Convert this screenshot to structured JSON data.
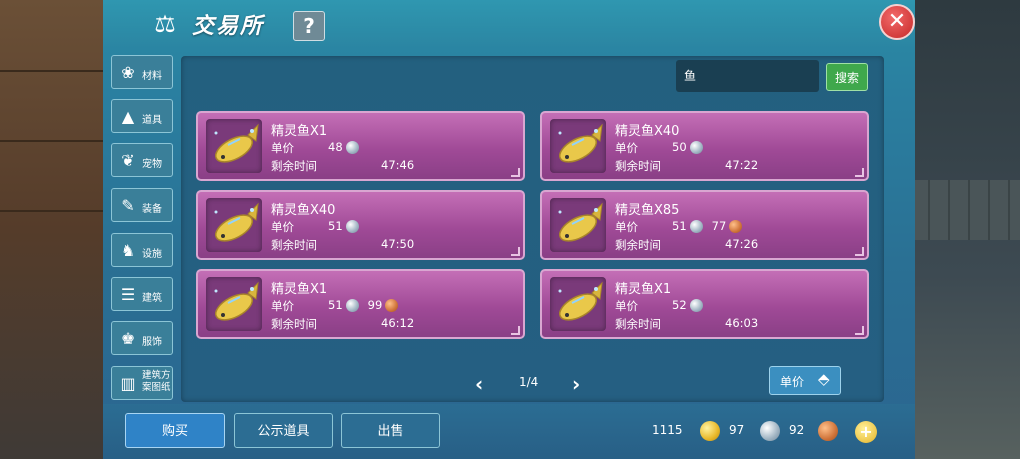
{
  "window": {
    "title": "交易所",
    "help_label": "?",
    "close_label": "✕"
  },
  "categories": [
    {
      "label": "材料",
      "icon": "material-icon",
      "glyph": "❀"
    },
    {
      "label": "道具",
      "icon": "tool-icon",
      "glyph": "▲"
    },
    {
      "label": "宠物",
      "icon": "pet-paw-icon",
      "glyph": "❦"
    },
    {
      "label": "装备",
      "icon": "equipment-icon",
      "glyph": "✎"
    },
    {
      "label": "设施",
      "icon": "facility-icon",
      "glyph": "♞"
    },
    {
      "label": "建筑",
      "icon": "building-icon",
      "glyph": "☰"
    },
    {
      "label": "服饰",
      "icon": "clothing-icon",
      "glyph": "♚"
    },
    {
      "label": "建筑方案图纸",
      "icon": "blueprint-icon",
      "glyph": "▥"
    }
  ],
  "search": {
    "value": "鱼",
    "button_label": "搜索"
  },
  "price_label": "单价",
  "time_label": "剩余时间",
  "items": [
    {
      "name": "精灵鱼X1",
      "silver": "48",
      "copper": "",
      "time": "47:46"
    },
    {
      "name": "精灵鱼X40",
      "silver": "50",
      "copper": "",
      "time": "47:22"
    },
    {
      "name": "精灵鱼X40",
      "silver": "51",
      "copper": "",
      "time": "47:50"
    },
    {
      "name": "精灵鱼X85",
      "silver": "51",
      "copper": "77",
      "time": "47:26"
    },
    {
      "name": "精灵鱼X1",
      "silver": "51",
      "copper": "99",
      "time": "46:12"
    },
    {
      "name": "精灵鱼X1",
      "silver": "52",
      "copper": "",
      "time": "46:03"
    }
  ],
  "pagination": {
    "prev": "‹",
    "next": "›",
    "page": "1/4"
  },
  "sort_button": {
    "label": "单价",
    "icon": "sort-diamond-icon"
  },
  "actions": {
    "buy": "购买",
    "publicize": "公示道具",
    "sell": "出售"
  },
  "currency": {
    "gold": "1115",
    "silver": "97",
    "copper": "92",
    "add": "+"
  },
  "colors": {
    "panel": "#2a7fa0",
    "card": "#a04a97",
    "search_button": "#3fa84c",
    "close_button": "#c62828"
  }
}
